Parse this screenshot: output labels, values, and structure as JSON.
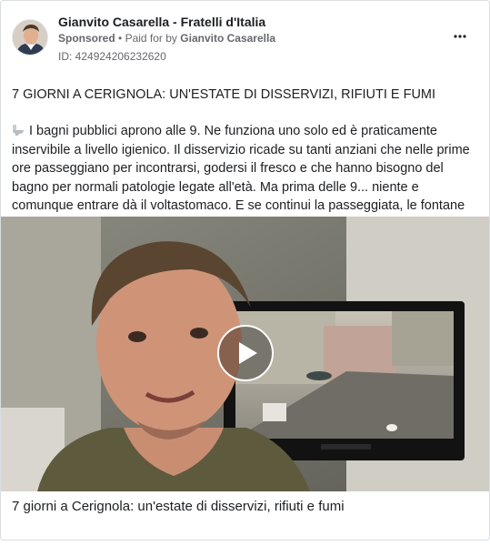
{
  "post": {
    "page_name": "Gianvito Casarella - Fratelli d'Italia",
    "sponsored_label": "Sponsored",
    "separator": "•",
    "paid_for_prefix": "Paid for by",
    "paid_for_name": "Gianvito Casarella",
    "ad_id": "ID: 424924206232620",
    "more_icon": "more-options-icon",
    "title": "7 GIORNI A CERIGNOLA: UN'ESTATE DI DISSERVIZI, RIFIUTI E FUMI",
    "body_icon": "toilet-icon",
    "body": "I bagni pubblici aprono alle 9. Ne funziona uno solo ed è praticamente inservibile a livello igienico. Il disservizio ricade su tanti anziani che nelle prime ore passeggiano per incontrarsi, godersi il fresco e che hanno bisogno del bagno per normali patologie legate all'età. Ma prima delle 9... niente e comunque entrare dà il voltastomaco. E se continui la passeggiata, le fontane sono chiuse. D'estate....",
    "media_icon": "play-icon",
    "caption": "7 giorni a Cerignola: un'estate di disservizi, rifiuti e fumi"
  }
}
